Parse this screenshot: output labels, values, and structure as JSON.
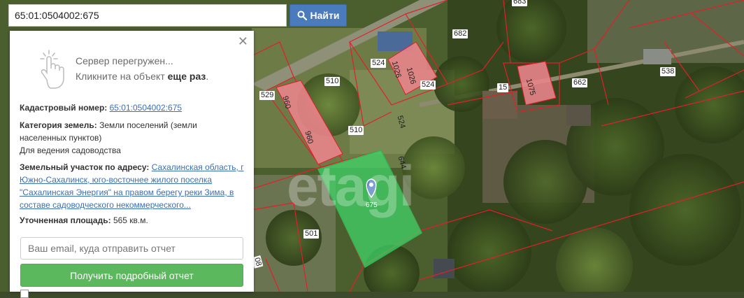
{
  "search": {
    "value": "65:01:0504002:675",
    "button_label": "Найти"
  },
  "panel": {
    "notice_line1": "Сервер перегружен...",
    "notice_line2_prefix": "Кликните на объект ",
    "notice_line2_bold": "еще раз",
    "notice_line2_suffix": ".",
    "cadastral_label": "Кадастровый номер:",
    "cadastral_value": "65:01:0504002:675",
    "category_label": "Категория земель:",
    "category_value": "Земли поселений (земли населенных пунктов)",
    "usage_value": "Для ведения садоводства",
    "address_label": "Земельный участок по адресу:",
    "address_value": "Сахалинская область, г Южно-Сахалинск, юго-восточнее жилого поселка \"Сахалинская Энергия\" на правом берегу реки Зима, в составе садоводческого некоммерческого...",
    "area_label": "Уточненная площадь:",
    "area_value": "565 кв.м.",
    "email_placeholder": "Ваш email, куда отправить отчет",
    "report_button": "Получить подробный отчет"
  },
  "map": {
    "watermark": "etagi",
    "selected_plot": "675",
    "plot_labels": [
      "683",
      "682",
      "524",
      "1026",
      "1026",
      "524",
      "538",
      "510",
      "15",
      "1075",
      "662",
      "529",
      "960",
      "960",
      "510",
      "524",
      "644",
      "501",
      "08"
    ],
    "colors": {
      "selected_fill": "#3fd86a",
      "building_fill": "#e8848a",
      "boundary": "#e0202a",
      "marker": "#4a7bbd"
    }
  }
}
